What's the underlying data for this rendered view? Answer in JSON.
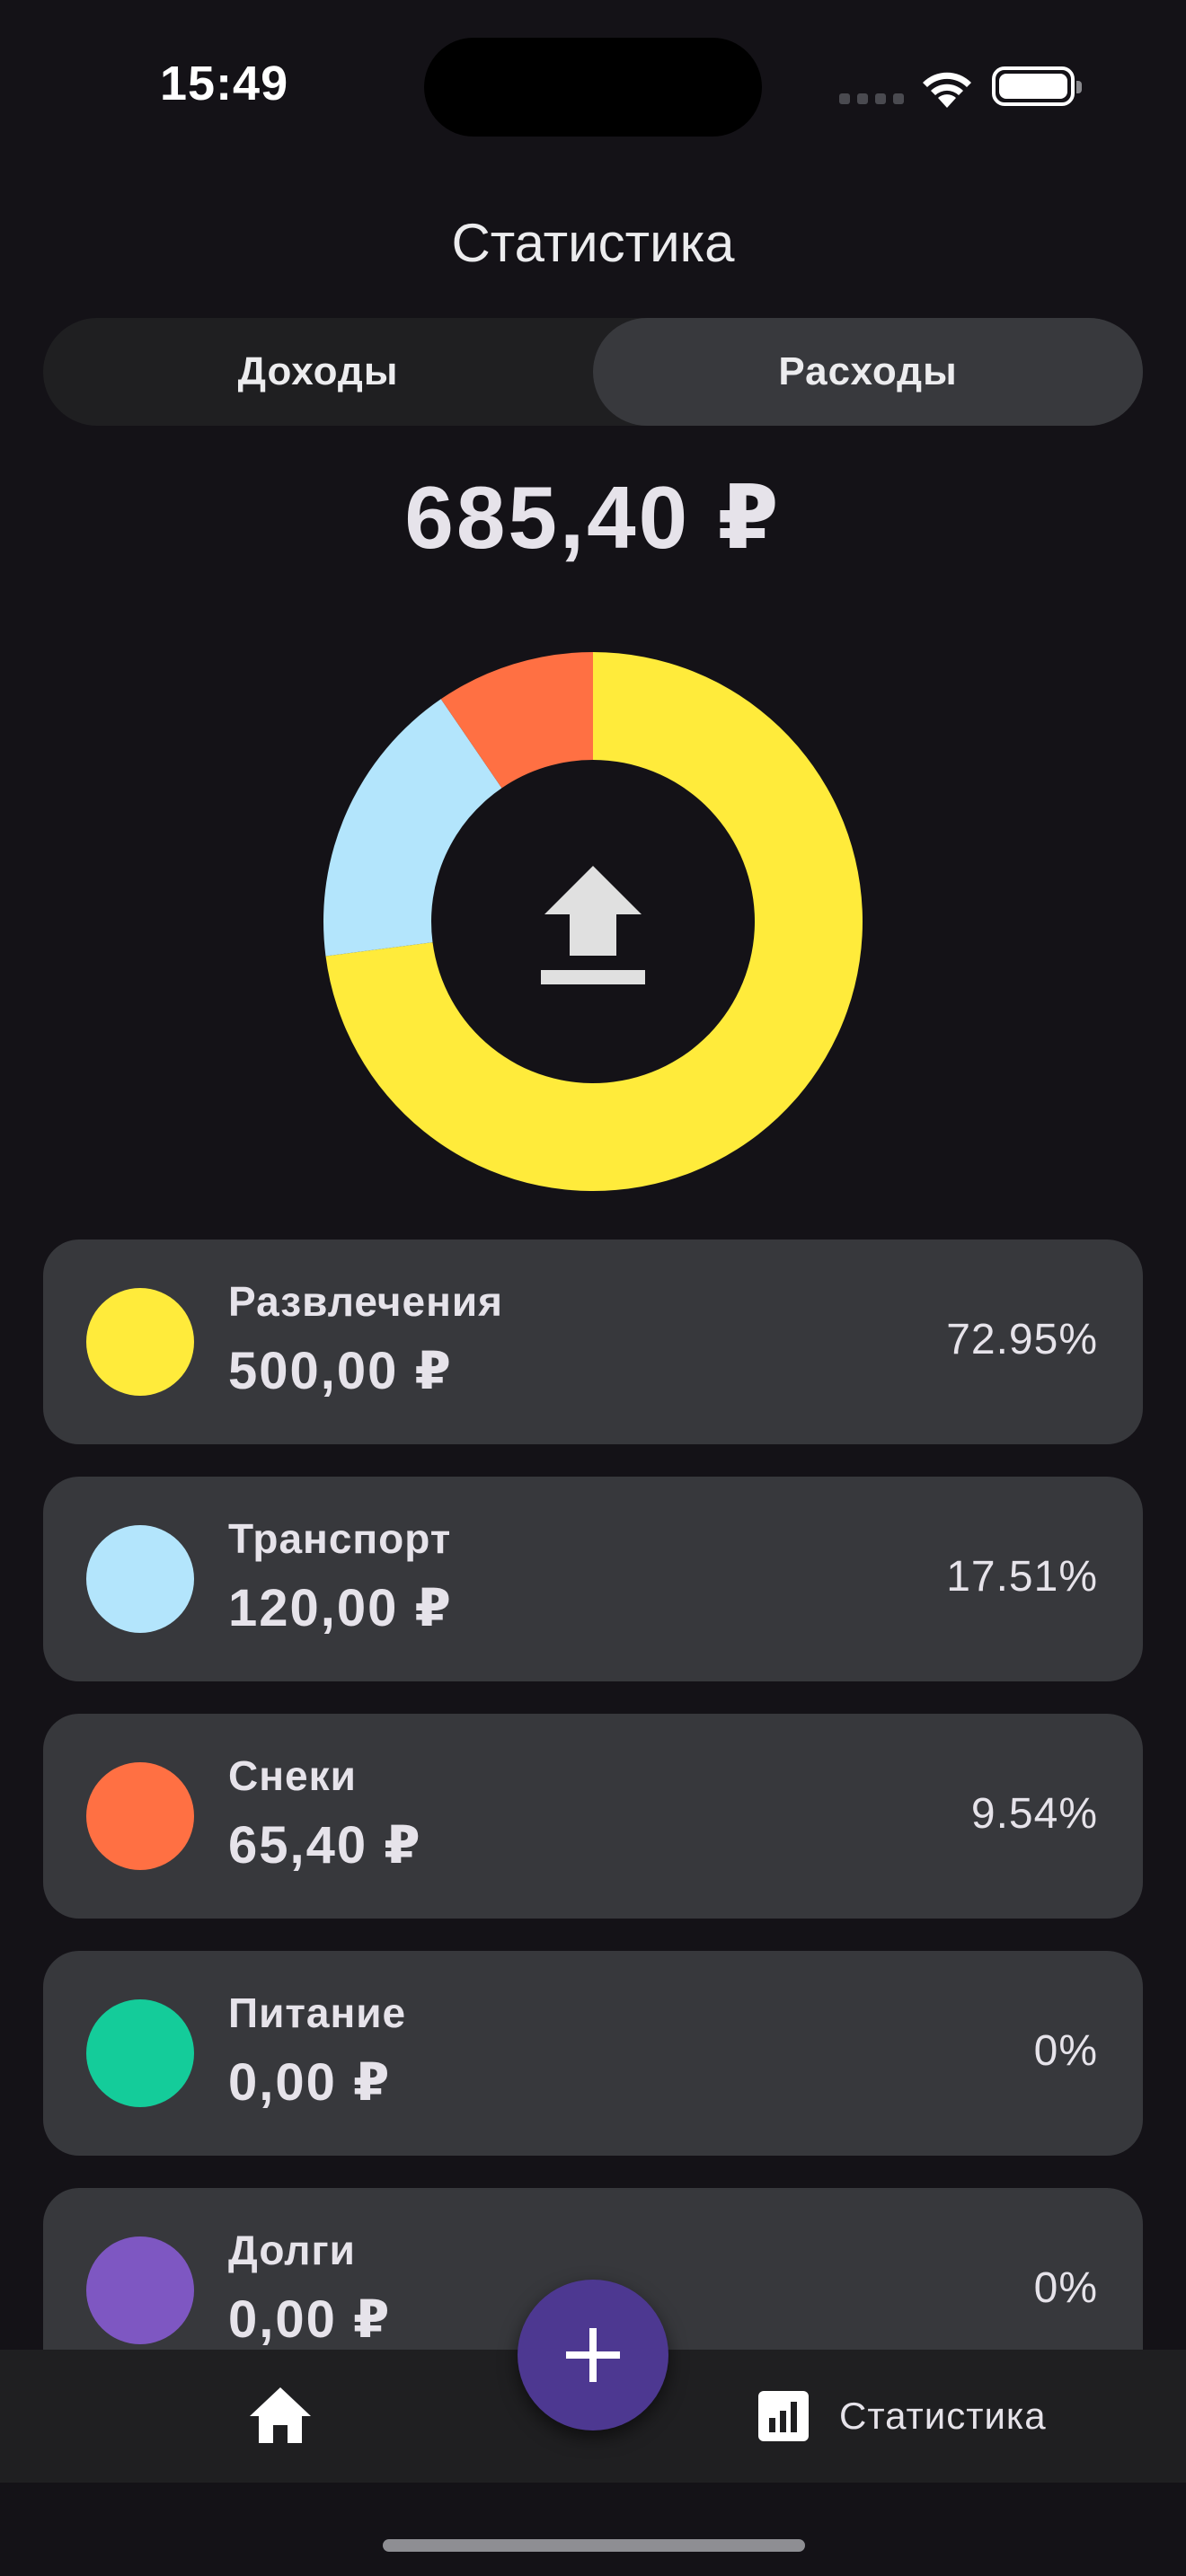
{
  "status_bar": {
    "time": "15:49"
  },
  "header": {
    "title": "Статистика"
  },
  "segment": {
    "tabs": [
      {
        "label": "Доходы",
        "active": false
      },
      {
        "label": "Расходы",
        "active": true
      }
    ]
  },
  "summary": {
    "total": "685,40 ₽"
  },
  "chart_data": {
    "type": "pie",
    "title": "",
    "categories": [
      "Развлечения",
      "Транспорт",
      "Снеки"
    ],
    "values": [
      72.95,
      17.51,
      9.54
    ],
    "colors": [
      "#FFEB3B",
      "#B3E5FC",
      "#FF7043"
    ],
    "center_icon": "upload-arrow-icon"
  },
  "categories": [
    {
      "name": "Развлечения",
      "amount": "500,00 ₽",
      "percent": "72.95%",
      "color": "#FFEB3B"
    },
    {
      "name": "Транспорт",
      "amount": "120,00 ₽",
      "percent": "17.51%",
      "color": "#B3E5FC"
    },
    {
      "name": "Снеки",
      "amount": "65,40 ₽",
      "percent": "9.54%",
      "color": "#FF7043"
    },
    {
      "name": "Питание",
      "amount": "0,00 ₽",
      "percent": "0%",
      "color": "#14CC9A"
    },
    {
      "name": "Долги",
      "amount": "0,00 ₽",
      "percent": "0%",
      "color": "#7E57C2"
    }
  ],
  "bottom_nav": {
    "home_icon": "home-icon",
    "stats_icon": "bar-chart-icon",
    "stats_label": "Статистика",
    "fab_icon": "plus-icon"
  },
  "colors": {
    "background": "#141217",
    "card": "#37383C",
    "segment_active": "#38393D",
    "fab": "#4D3891"
  }
}
